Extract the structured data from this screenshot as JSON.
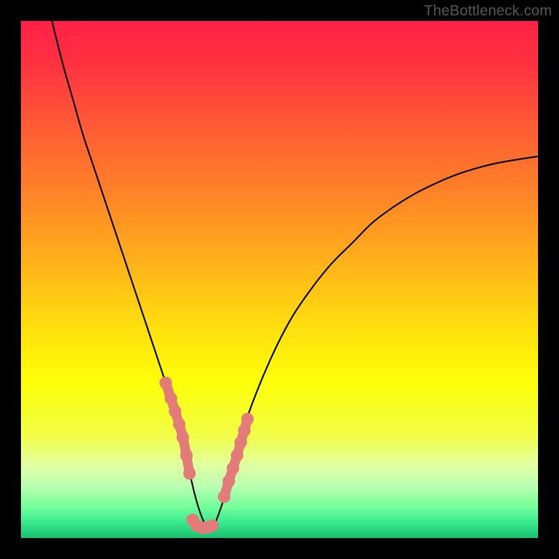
{
  "watermark": "TheBottleneck.com",
  "chart_data": {
    "type": "line",
    "title": "",
    "xlabel": "",
    "ylabel": "",
    "xlim": [
      0,
      100
    ],
    "ylim": [
      0,
      100
    ],
    "background_gradient": {
      "stops": [
        {
          "offset": 0.0,
          "color": "#ff2046"
        },
        {
          "offset": 0.09,
          "color": "#ff3440"
        },
        {
          "offset": 0.2,
          "color": "#ff5a35"
        },
        {
          "offset": 0.33,
          "color": "#ff8228"
        },
        {
          "offset": 0.46,
          "color": "#ffaf1b"
        },
        {
          "offset": 0.58,
          "color": "#ffdb0f"
        },
        {
          "offset": 0.7,
          "color": "#fdff08"
        },
        {
          "offset": 0.8,
          "color": "#f2ff45"
        },
        {
          "offset": 0.86,
          "color": "#e0ffa2"
        },
        {
          "offset": 0.9,
          "color": "#baffb1"
        },
        {
          "offset": 0.94,
          "color": "#73ff9a"
        },
        {
          "offset": 0.97,
          "color": "#39e98e"
        },
        {
          "offset": 1.0,
          "color": "#18c06f"
        }
      ]
    },
    "series": [
      {
        "name": "curve",
        "color": "#000000",
        "x": [
          6,
          8,
          10,
          12,
          14,
          16,
          18,
          20,
          22,
          24,
          26,
          28,
          30,
          32,
          33,
          34,
          35,
          36,
          37,
          38,
          40,
          42,
          44,
          48,
          52,
          56,
          60,
          64,
          68,
          72,
          76,
          80,
          84,
          88,
          92,
          96,
          100
        ],
        "y": [
          100,
          92,
          85,
          78,
          72,
          66,
          60,
          54,
          48,
          42,
          36,
          30,
          24,
          16,
          11,
          7,
          4,
          2,
          2,
          4,
          10,
          17,
          24,
          34,
          42,
          48,
          53,
          57,
          61,
          64,
          66.5,
          68.5,
          70.2,
          71.5,
          72.5,
          73.2,
          73.8
        ]
      }
    ],
    "marker_runs": [
      {
        "name": "left-run",
        "color": "#e37c78",
        "x": [
          28.0,
          29.0,
          29.8,
          30.6,
          31.3,
          32.0,
          32.6
        ],
        "y": [
          30.0,
          27.0,
          24.5,
          22.0,
          19.5,
          16.0,
          12.5
        ]
      },
      {
        "name": "bottom-run",
        "color": "#e37c78",
        "x": [
          33.2,
          34.0,
          35.0,
          36.0,
          37.0
        ],
        "y": [
          3.5,
          2.4,
          2.0,
          2.0,
          2.4
        ]
      },
      {
        "name": "right-run",
        "color": "#e37c78",
        "x": [
          39.3,
          40.2,
          41.0,
          41.8,
          42.5,
          43.2,
          43.8
        ],
        "y": [
          8.0,
          11.0,
          13.5,
          16.0,
          18.5,
          20.8,
          23.0
        ]
      }
    ]
  }
}
